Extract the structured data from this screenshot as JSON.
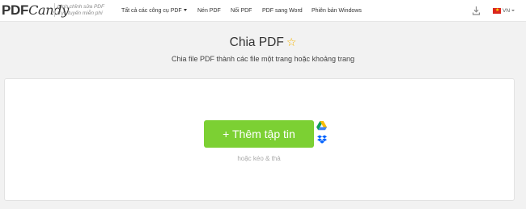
{
  "header": {
    "logo_pdf": "PDF",
    "logo_candy": "Candy",
    "tagline_1": "trình chỉnh sửa PDF",
    "tagline_2": "trực tuyến miễn phí",
    "nav": {
      "all_tools": "Tất cả các công cụ PDF",
      "compress": "Nén PDF",
      "merge": "Nối PDF",
      "to_word": "PDF sang Word",
      "windows": "Phiên bản Windows"
    },
    "language": "VN"
  },
  "main": {
    "title": "Chia PDF",
    "subtitle": "Chia file PDF thành các file một trang hoặc khoảng trang"
  },
  "upload": {
    "add_button": "+ Thêm tập tin",
    "drag_drop": "hoặc kéo & thả"
  },
  "colors": {
    "accent_green": "#7cd033",
    "star_yellow": "#f5b400",
    "flag_red": "#da251d"
  },
  "icons": [
    "download-icon",
    "vietnam-flag-icon",
    "star-icon",
    "google-drive-icon",
    "dropbox-icon"
  ]
}
